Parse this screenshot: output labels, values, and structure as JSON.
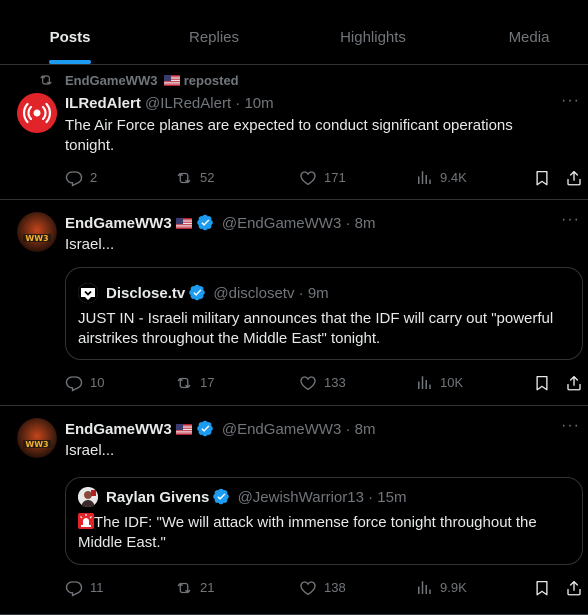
{
  "tabs": [
    {
      "label": "Posts",
      "active": true
    },
    {
      "label": "Replies",
      "active": false
    },
    {
      "label": "Highlights",
      "active": false
    },
    {
      "label": "Media",
      "active": false
    }
  ],
  "colors": {
    "accent": "#1d9bf0",
    "muted": "#71767b",
    "text": "#e7e9ea",
    "border": "#2f3336"
  },
  "posts": [
    {
      "repost": {
        "user": "EndGameWW3",
        "label": "reposted"
      },
      "author": {
        "name": "ILRedAlert",
        "handle": "@ILRedAlert",
        "time": "· 10m",
        "verified": false,
        "avatar_icon": "red-alert-siren-icon"
      },
      "text": "The Air Force planes are expected to conduct significant operations tonight.",
      "stats": {
        "replies": "2",
        "reposts": "52",
        "likes": "171",
        "views": "9.4K"
      }
    },
    {
      "author": {
        "name": "EndGameWW3",
        "handle": "@EndGameWW3",
        "time": "· 8m",
        "verified": true,
        "avatar_icon": "ww3-logo-icon"
      },
      "text": "Israel...",
      "quote": {
        "name": "Disclose.tv",
        "handle": "@disclosetv",
        "time": "· 9m",
        "verified": true,
        "avatar_icon": "disclose-tv-logo-icon",
        "text": "JUST IN - Israeli military announces that the IDF will carry out \"powerful airstrikes throughout the Middle East\" tonight."
      },
      "stats": {
        "replies": "10",
        "reposts": "17",
        "likes": "133",
        "views": "10K"
      }
    },
    {
      "author": {
        "name": "EndGameWW3",
        "handle": "@EndGameWW3",
        "time": "· 8m",
        "verified": true,
        "avatar_icon": "ww3-logo-icon"
      },
      "text": "Israel...",
      "quote": {
        "name": "Raylan Givens",
        "handle": "@JewishWarrior13",
        "time": "· 15m",
        "verified": true,
        "avatar_icon": "user-photo-icon",
        "text_emoji": "🚨",
        "text": "The IDF: \"We will attack with immense force tonight throughout the Middle East.\""
      },
      "stats": {
        "replies": "11",
        "reposts": "21",
        "likes": "138",
        "views": "9.9K"
      }
    }
  ],
  "more_glyph": "···"
}
